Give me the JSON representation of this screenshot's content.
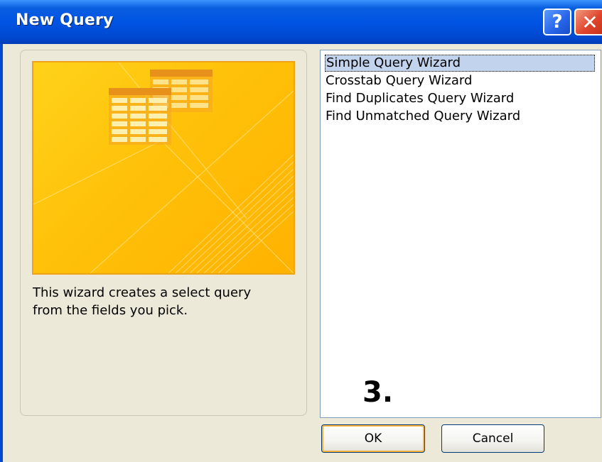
{
  "window": {
    "title": "New Query"
  },
  "titlebar_buttons": {
    "help": "?",
    "close": "✕"
  },
  "wizard_description": {
    "line1": "This wizard creates a select query",
    "line2": "from the fields you pick."
  },
  "wizard_list": {
    "items": [
      {
        "label": "Simple Query Wizard",
        "selected": true
      },
      {
        "label": "Crosstab Query Wizard",
        "selected": false
      },
      {
        "label": "Find Duplicates Query Wizard",
        "selected": false
      },
      {
        "label": "Find Unmatched Query Wizard",
        "selected": false
      }
    ]
  },
  "annotation": {
    "step": "3."
  },
  "buttons": {
    "ok": "OK",
    "cancel": "Cancel"
  },
  "colors": {
    "titlebar": "#0054E3",
    "selection": "#C2D3EE",
    "preview_bg": "#FFC10A",
    "preview_border": "#F0A318"
  }
}
